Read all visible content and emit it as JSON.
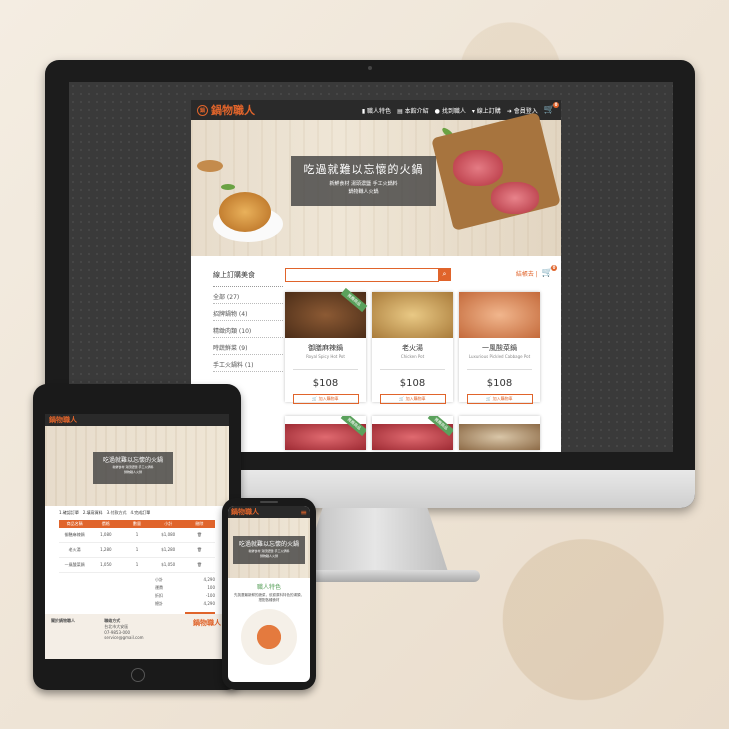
{
  "brand": {
    "name": "鍋物職人",
    "badge": "鍋",
    "accent": "#e0642b",
    "green": "#5aa15c"
  },
  "desktop": {
    "nav": [
      {
        "icon": "user-icon",
        "label": "職人特色"
      },
      {
        "icon": "doc-icon",
        "label": "本館介紹"
      },
      {
        "icon": "pin-icon",
        "label": "找到職人"
      },
      {
        "icon": "cart-icon",
        "label": "線上訂購"
      },
      {
        "icon": "login-icon",
        "label": "會員登入"
      }
    ],
    "cart_count": "0",
    "hero": {
      "title": "吃過就難以忘懷的火鍋",
      "line1": "新鮮食材 湯頭濃鹽 手工火鍋料",
      "line2": "鍋物職人火鍋"
    },
    "sidebar": {
      "title": "線上訂購美食",
      "items": [
        "全部 (27)",
        "招牌鍋物 (4)",
        "精緻肉類 (10)",
        "時蔬鮮菜 (9)",
        "手工火鍋料 (1)"
      ]
    },
    "checkout_label": "結帳去 |",
    "products": [
      {
        "name": "御膳麻辣鍋",
        "en": "Royal Spicy Hot Pot",
        "price": "$108",
        "ribbon": "推薦商品",
        "add": "加入購物車"
      },
      {
        "name": "老火湯",
        "en": "Chicken Pot",
        "price": "$108",
        "ribbon": "",
        "add": "加入購物車"
      },
      {
        "name": "一風酸菜鍋",
        "en": "Luxurious Pickled Cabbage Pot",
        "price": "$108",
        "ribbon": "",
        "add": "加入購物車"
      }
    ],
    "products_row2_ribbons": [
      "推薦商品",
      "推薦商品"
    ]
  },
  "tablet": {
    "hero": {
      "title": "吃過就難以忘懷的火鍋",
      "line1": "新鮮食材 湯頭濃鹽 手工火鍋料",
      "line2": "鍋物職人火鍋"
    },
    "steps": [
      "1.確認訂單",
      "2.填寫資料",
      "3.付款方式",
      "4.完成訂單"
    ],
    "table_headers": [
      "商品名稱",
      "價格",
      "數量",
      "小計",
      "刪除"
    ],
    "rows": [
      {
        "name": "御膳麻辣鍋",
        "price": "1,080",
        "qty": "1",
        "sub": "$1,080"
      },
      {
        "name": "老火湯",
        "price": "1,280",
        "qty": "1",
        "sub": "$1,280"
      },
      {
        "name": "一風酸菜鍋",
        "price": "1,050",
        "qty": "1",
        "sub": "$1,050"
      }
    ],
    "totals": [
      {
        "label": "小計",
        "value": "4,290"
      },
      {
        "label": "運費",
        "value": "100"
      },
      {
        "label": "折扣",
        "value": "-100"
      },
      {
        "label": "總計",
        "value": "4,290"
      }
    ],
    "footer": {
      "col1_title": "關於鍋物職人",
      "col2_title": "聯絡方式",
      "col2_lines": [
        "台北市大安區",
        "07-9853-000",
        "service@gmail.com"
      ]
    }
  },
  "phone": {
    "hero": {
      "title": "吃過就難以忘懷的火鍋",
      "line1": "新鮮食材 湯頭濃鹽 手工火鍋料",
      "line2": "鍋物職人火鍋"
    },
    "section_title": "職人特色",
    "section_text": "先挑選最新鮮的蔬菜，依據原料特色的湯頭，搭配各種食材"
  }
}
